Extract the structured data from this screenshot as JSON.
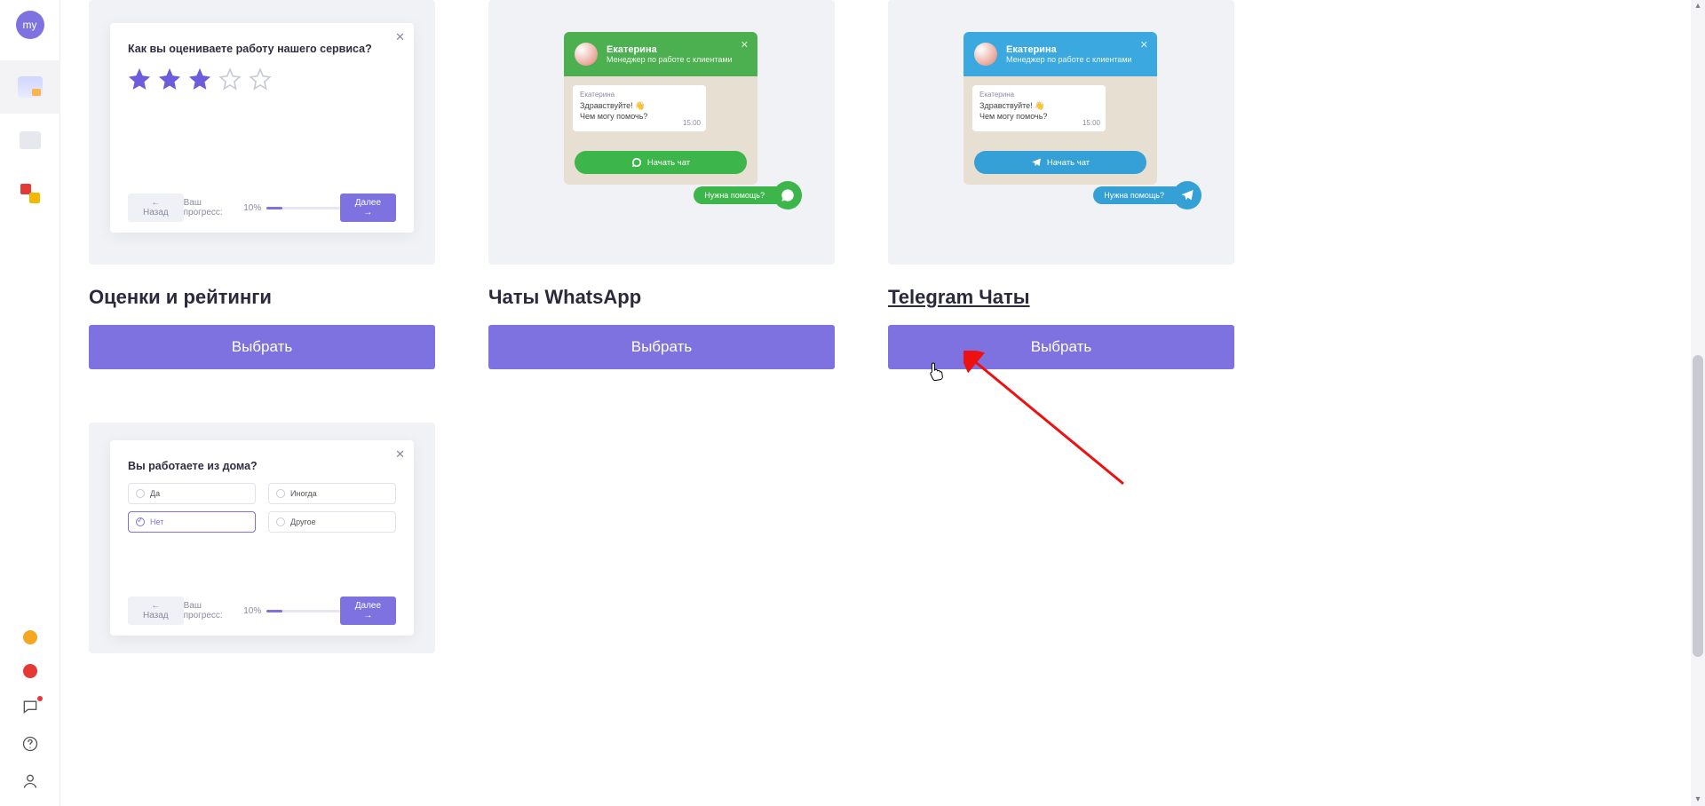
{
  "sidebar": {
    "avatar_label": "my"
  },
  "cards": {
    "ratings": {
      "title": "Оценки и рейтинги",
      "cta": "Выбрать",
      "survey": {
        "question": "Как вы оцениваете работу нашего сервиса?",
        "progress_label": "Ваш прогресс:",
        "progress_value": "10%",
        "back": "← Назад",
        "next": "Далее →"
      }
    },
    "whatsapp": {
      "title": "Чаты WhatsApp",
      "cta": "Выбрать",
      "chat": {
        "agent_name": "Екатерина",
        "agent_role": "Менеджер по работе с клиентами",
        "msg_from": "Екатерина",
        "msg_line1": "Здравствуйте! 👋",
        "msg_line2": "Чем могу помочь?",
        "msg_time": "15:00",
        "cta": "Начать чат",
        "fab": "Нужна помощь?"
      }
    },
    "telegram": {
      "title": "Telegram Чаты",
      "cta": "Выбрать",
      "chat": {
        "agent_name": "Екатерина",
        "agent_role": "Менеджер по работе с клиентами",
        "msg_from": "Екатерина",
        "msg_line1": "Здравствуйте! 👋",
        "msg_line2": "Чем могу помочь?",
        "msg_time": "15:00",
        "cta": "Начать чат",
        "fab": "Нужна помощь?"
      }
    },
    "radio_survey": {
      "question": "Вы работаете из дома?",
      "opts": {
        "yes": "Да",
        "sometimes": "Иногда",
        "no": "Нет",
        "other": "Другое"
      },
      "progress_label": "Ваш прогресс:",
      "progress_value": "10%",
      "back": "← Назад",
      "next": "Далее →"
    }
  }
}
